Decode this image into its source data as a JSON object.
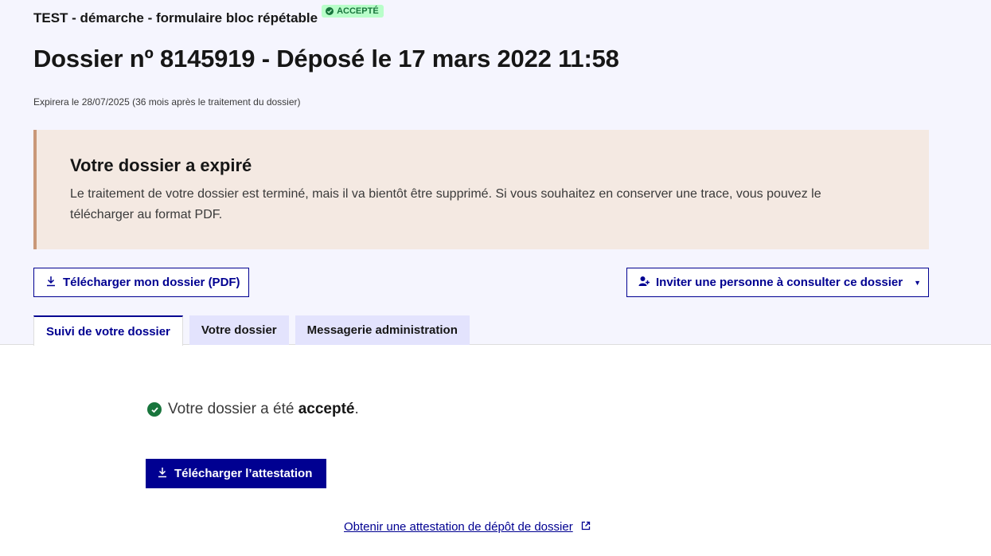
{
  "header": {
    "procedure_title": "TEST - démarche - formulaire bloc répétable",
    "status_badge": "ACCEPTÉ",
    "dossier_title": "Dossier nº 8145919 - Déposé le 17 mars 2022 11:58",
    "expiry_note": "Expirera le 28/07/2025 (36 mois après le traitement du dossier)"
  },
  "alert": {
    "title": "Votre dossier a expiré",
    "body": "Le traitement de votre dossier est terminé, mais il va bientôt être supprimé. Si vous souhaitez en conserver une trace, vous pouvez le télécharger au format PDF."
  },
  "actions": {
    "download_pdf_label": "Télécharger mon dossier (PDF)",
    "invite_label": "Inviter une personne à consulter ce dossier"
  },
  "tabs": [
    {
      "label": "Suivi de votre dossier",
      "active": true
    },
    {
      "label": "Votre dossier",
      "active": false
    },
    {
      "label": "Messagerie administration",
      "active": false
    }
  ],
  "suivi": {
    "status_prefix": "Votre dossier a été ",
    "status_value": "accepté",
    "status_suffix": ".",
    "attestation_button": "Télécharger l’attestation",
    "depot_link": "Obtenir une attestation de dépôt de dossier"
  },
  "icons": {
    "download": "download-icon",
    "user_add": "user-add-icon",
    "check": "check-circle-icon",
    "external": "external-link-icon"
  },
  "colors": {
    "primary": "#000091",
    "success": "#18753c",
    "badge_bg": "#b8fec9",
    "alert_bg": "#f4e9e2",
    "alert_border": "#c99878",
    "header_bg": "#f5f5fe"
  }
}
